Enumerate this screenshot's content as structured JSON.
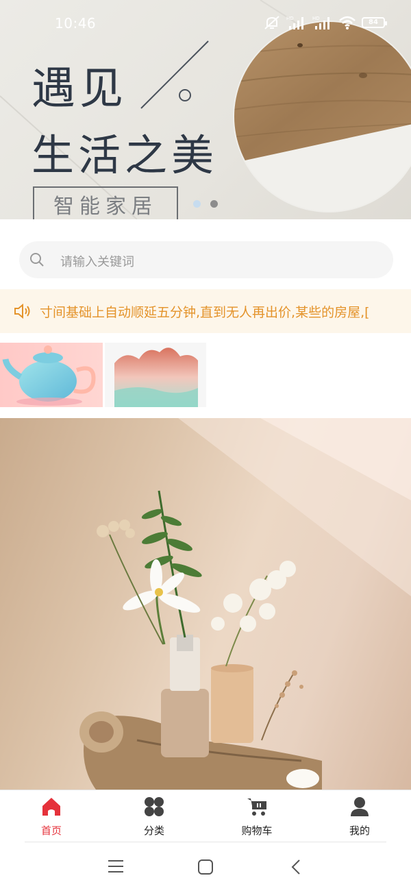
{
  "status_bar": {
    "time": "10:46",
    "battery": "84"
  },
  "banner": {
    "title_line1": "遇见",
    "title_line2": "生活之美",
    "tag": "智能家居",
    "active_dot_color": "#c7dcef",
    "inactive_dot_color": "#8c8c8c"
  },
  "search": {
    "placeholder": "请输入关键词",
    "icon": "search-icon"
  },
  "notice": {
    "icon": "speaker-icon",
    "text": "寸间基础上自动顺延五分钟,直到无人再出价,某些的房屋,["
  },
  "thumbnails": [
    {
      "name": "teapot"
    },
    {
      "name": "mountain-vase"
    }
  ],
  "tabbar": {
    "items": [
      {
        "label": "首页",
        "icon": "home-icon",
        "active": true
      },
      {
        "label": "分类",
        "icon": "category-icon",
        "active": false
      },
      {
        "label": "购物车",
        "icon": "cart-icon",
        "active": false
      },
      {
        "label": "我的",
        "icon": "user-icon",
        "active": false
      }
    ],
    "active_color": "#e5323b"
  },
  "system_nav": {
    "items": [
      "menu-icon",
      "home-square-icon",
      "back-icon"
    ]
  }
}
